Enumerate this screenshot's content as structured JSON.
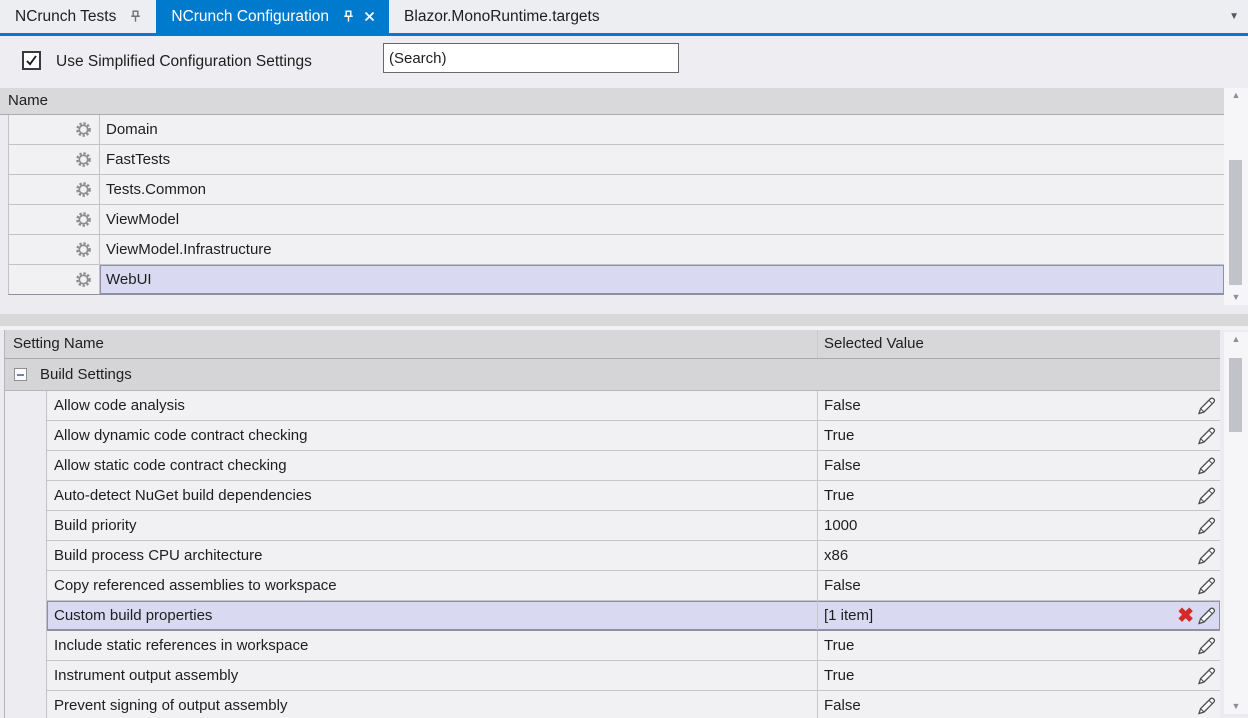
{
  "tabs": [
    {
      "label": "NCrunch Tests",
      "pinned": true,
      "active": false
    },
    {
      "label": "NCrunch Configuration",
      "pinned": true,
      "active": true,
      "closable": true
    },
    {
      "label": "Blazor.MonoRuntime.targets",
      "pinned": false,
      "active": false
    }
  ],
  "tab_overflow_icon": "▼",
  "toolbar": {
    "checkbox_label": "Use Simplified Configuration Settings",
    "checkbox_checked": true,
    "search_value": "(Search)"
  },
  "projects": {
    "header": "Name",
    "selected_index": 5,
    "items": [
      {
        "name": "Domain"
      },
      {
        "name": "FastTests"
      },
      {
        "name": "Tests.Common"
      },
      {
        "name": "ViewModel"
      },
      {
        "name": "ViewModel.Infrastructure"
      },
      {
        "name": "WebUI"
      }
    ]
  },
  "settings": {
    "columns": {
      "name": "Setting Name",
      "value": "Selected Value"
    },
    "group_label": "Build Settings",
    "group_expanded": true,
    "selected_index": 7,
    "rows": [
      {
        "name": "Allow code analysis",
        "value": "False"
      },
      {
        "name": "Allow dynamic code contract checking",
        "value": "True"
      },
      {
        "name": "Allow static code contract checking",
        "value": "False"
      },
      {
        "name": "Auto-detect NuGet build dependencies",
        "value": "True"
      },
      {
        "name": "Build priority",
        "value": "1000"
      },
      {
        "name": "Build process CPU architecture",
        "value": "x86"
      },
      {
        "name": "Copy referenced assemblies to workspace",
        "value": "False"
      },
      {
        "name": "Custom build properties",
        "value": "[1 item]",
        "selected": true,
        "deletable": true
      },
      {
        "name": "Include static references in workspace",
        "value": "True"
      },
      {
        "name": "Instrument output assembly",
        "value": "True"
      },
      {
        "name": "Prevent signing of output assembly",
        "value": "False"
      }
    ]
  },
  "scrollbars": {
    "up_icon": "▲",
    "down_icon": "▼",
    "delete_icon": "✖"
  },
  "colors": {
    "accent": "#007acc",
    "selection_fill": "#d9d9f2",
    "selection_border": "#8f8fa8",
    "delete_red": "#d42a2a"
  }
}
